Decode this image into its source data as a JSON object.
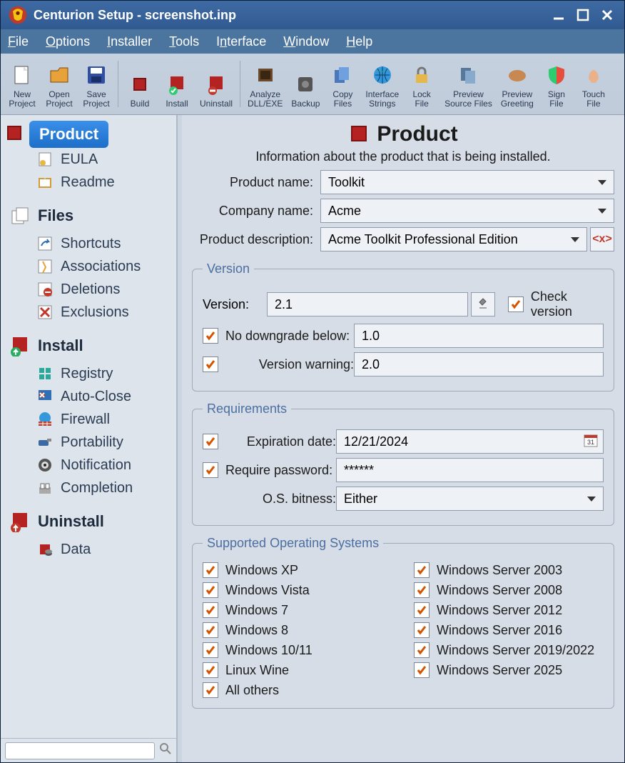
{
  "window": {
    "title": "Centurion Setup - screenshot.inp"
  },
  "menu": {
    "file": "File",
    "options": "Options",
    "installer": "Installer",
    "tools": "Tools",
    "interface": "Interface",
    "window": "Window",
    "help": "Help"
  },
  "toolbar": {
    "new": "New\nProject",
    "open": "Open\nProject",
    "save": "Save\nProject",
    "build": "Build",
    "install": "Install",
    "uninstall": "Uninstall",
    "analyze": "Analyze\nDLL/EXE",
    "backup": "Backup",
    "copy": "Copy\nFiles",
    "strings": "Interface\nStrings",
    "lock": "Lock\nFile",
    "previewsrc": "Preview\nSource Files",
    "previewgreet": "Preview\nGreeting",
    "sign": "Sign\nFile",
    "touch": "Touch\nFile"
  },
  "sidebar": {
    "product": "Product",
    "eula": "EULA",
    "readme": "Readme",
    "files": "Files",
    "shortcuts": "Shortcuts",
    "associations": "Associations",
    "deletions": "Deletions",
    "exclusions": "Exclusions",
    "install": "Install",
    "registry": "Registry",
    "autoclose": "Auto-Close",
    "firewall": "Firewall",
    "portability": "Portability",
    "notification": "Notification",
    "completion": "Completion",
    "uninstall": "Uninstall",
    "data": "Data"
  },
  "page": {
    "title": "Product",
    "subtitle": "Information about the product that is being installed.",
    "product_name_label": "Product name:",
    "product_name_value": "Toolkit",
    "company_label": "Company name:",
    "company_value": "Acme",
    "desc_label": "Product description:",
    "desc_value": "Acme Toolkit Professional Edition"
  },
  "version": {
    "legend": "Version",
    "version_label": "Version:",
    "version_value": "2.1",
    "check_label": "Check version",
    "nodown_label": "No downgrade below:",
    "nodown_value": "1.0",
    "warn_label": "Version warning:",
    "warn_value": "2.0"
  },
  "requirements": {
    "legend": "Requirements",
    "exp_label": "Expiration date:",
    "exp_value": "12/21/2024",
    "pwd_label": "Require password:",
    "pwd_value": "******",
    "bits_label": "O.S. bitness:",
    "bits_value": "Either"
  },
  "os": {
    "legend": "Supported Operating Systems",
    "left": [
      "Windows XP",
      "Windows Vista",
      "Windows 7",
      "Windows 8",
      "Windows 10/11",
      "Linux Wine",
      "All others"
    ],
    "right": [
      "Windows Server 2003",
      "Windows Server 2008",
      "Windows Server 2012",
      "Windows Server 2016",
      "Windows Server 2019/2022",
      "Windows Server 2025"
    ]
  }
}
